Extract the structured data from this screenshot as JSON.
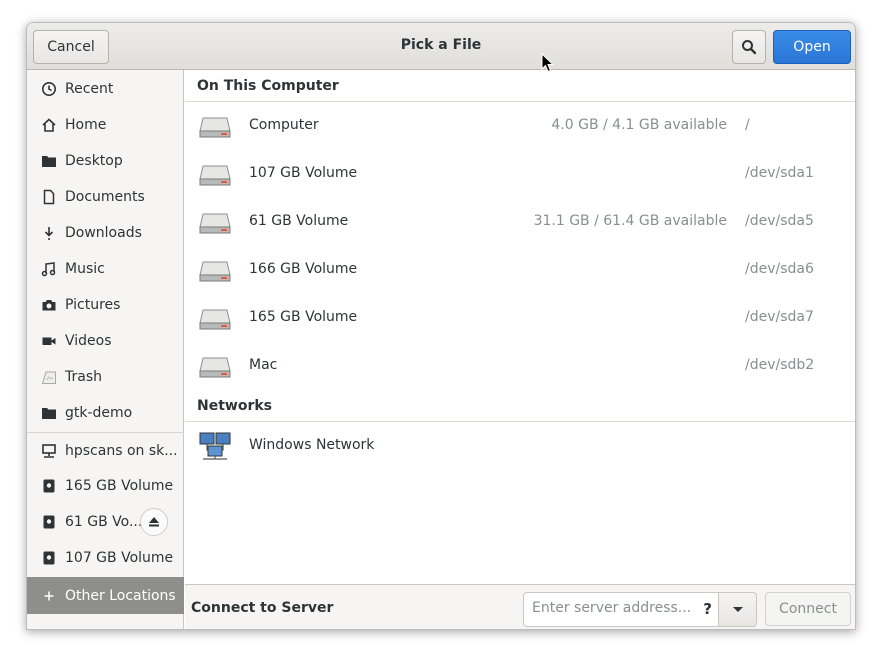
{
  "header": {
    "cancel_label": "Cancel",
    "title": "Pick a File",
    "search_icon": "search-icon",
    "open_label": "Open"
  },
  "sidebar": {
    "items": [
      {
        "label": "Recent",
        "icon": "clock-icon"
      },
      {
        "label": "Home",
        "icon": "home-icon"
      },
      {
        "label": "Desktop",
        "icon": "folder-icon"
      },
      {
        "label": "Documents",
        "icon": "document-icon"
      },
      {
        "label": "Downloads",
        "icon": "download-icon"
      },
      {
        "label": "Music",
        "icon": "music-icon"
      },
      {
        "label": "Pictures",
        "icon": "camera-icon"
      },
      {
        "label": "Videos",
        "icon": "video-icon"
      },
      {
        "label": "Trash",
        "icon": "trash-icon"
      },
      {
        "label": "gtk-demo",
        "icon": "folder-icon"
      }
    ],
    "devices": [
      {
        "label": "hpscans on sk...",
        "icon": "network-share-icon"
      },
      {
        "label": "165 GB Volume",
        "icon": "disk-icon"
      },
      {
        "label": "61 GB Vo...",
        "icon": "disk-icon",
        "eject": true
      },
      {
        "label": "107 GB Volume",
        "icon": "disk-icon"
      }
    ],
    "other_locations": {
      "label": "Other Locations",
      "icon": "plus-icon"
    }
  },
  "main": {
    "on_this_computer": {
      "heading": "On This Computer",
      "rows": [
        {
          "name": "Computer",
          "avail": "4.0 GB / 4.1 GB available",
          "path": "/"
        },
        {
          "name": "107 GB Volume",
          "avail": "",
          "path": "/dev/sda1"
        },
        {
          "name": "61 GB Volume",
          "avail": "31.1 GB / 61.4 GB available",
          "path": "/dev/sda5"
        },
        {
          "name": "166 GB Volume",
          "avail": "",
          "path": "/dev/sda6"
        },
        {
          "name": "165 GB Volume",
          "avail": "",
          "path": "/dev/sda7"
        },
        {
          "name": "Mac",
          "avail": "",
          "path": "/dev/sdb2"
        }
      ]
    },
    "networks": {
      "heading": "Networks",
      "rows": [
        {
          "name": "Windows Network"
        }
      ]
    }
  },
  "footer": {
    "label": "Connect to Server",
    "placeholder": "Enter server address...",
    "help_glyph": "?",
    "connect_label": "Connect"
  },
  "colors": {
    "accent": "#2a76d6",
    "selected_sidebar": "#8e8e8d",
    "dim_text": "#8b8e8f"
  }
}
